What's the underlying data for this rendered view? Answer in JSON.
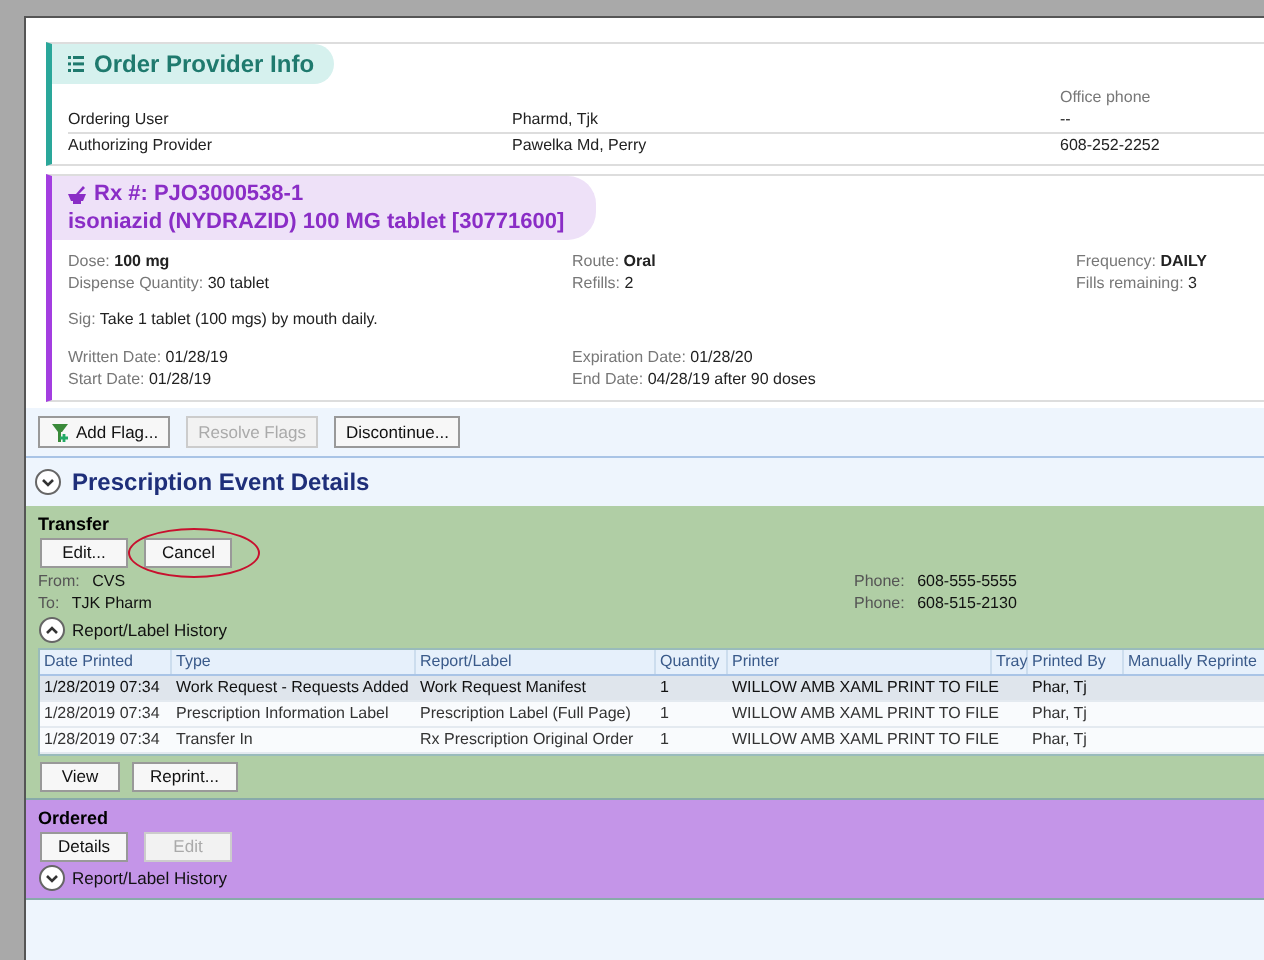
{
  "provider_info": {
    "title": "Order Provider Info",
    "phone_header": "Office phone",
    "rows": [
      {
        "label": "Ordering User",
        "name": "Pharmd, Tjk",
        "phone": "--"
      },
      {
        "label": "Authorizing Provider",
        "name": "Pawelka Md, Perry",
        "phone": "608-252-2252"
      }
    ]
  },
  "prescription": {
    "rx_number": "Rx #: PJO3000538-1",
    "drug": "isoniazid (NYDRAZID) 100 MG tablet [30771600]",
    "detail_columns": [
      [
        {
          "label": "Dose:",
          "value": "100 mg",
          "emphasis": true
        },
        {
          "label": "Dispense Quantity:",
          "value": "30 tablet",
          "emphasis": false
        }
      ],
      [
        {
          "label": "Route:",
          "value": "Oral",
          "emphasis": true
        },
        {
          "label": "Refills:",
          "value": "2",
          "emphasis": false
        }
      ],
      [
        {
          "label": "Frequency:",
          "value": "DAILY",
          "emphasis": true
        },
        {
          "label": "Fills remaining:",
          "value": "3",
          "emphasis": false
        }
      ]
    ],
    "sig": {
      "label": "Sig:",
      "value": "Take 1 tablet (100 mgs) by mouth daily."
    },
    "date_columns": [
      [
        {
          "label": "Written Date:",
          "value": "01/28/19",
          "emphasis": false
        },
        {
          "label": "Start Date:",
          "value": "01/28/19",
          "emphasis": false
        }
      ],
      [
        {
          "label": "Expiration Date:",
          "value": "01/28/20",
          "emphasis": false
        },
        {
          "label": "End Date:",
          "value": "04/28/19 after 90 doses",
          "emphasis": false
        }
      ]
    ]
  },
  "toolbar": [
    {
      "label": "Add Flag...",
      "kind": "flag",
      "disabled": false
    },
    {
      "label": "Resolve Flags",
      "kind": "plain",
      "disabled": true
    },
    {
      "label": "Discontinue...",
      "kind": "plain",
      "disabled": false
    }
  ],
  "event_details": {
    "title": "Prescription Event Details"
  },
  "events": [
    {
      "kind": "transfer",
      "title": "Transfer",
      "buttons": [
        {
          "label": "Edit...",
          "disabled": false,
          "circled": false
        },
        {
          "label": "Cancel",
          "disabled": false,
          "circled": true
        }
      ],
      "parties": [
        {
          "label": "From:",
          "value": "CVS",
          "phone_label": "Phone:",
          "phone": "608-555-5555"
        },
        {
          "label": "To:",
          "value": "TJK Pharm",
          "phone_label": "Phone:",
          "phone": "608-515-2130"
        }
      ],
      "history": {
        "label": "Report/Label History",
        "expanded": true,
        "columns": [
          "Date Printed",
          "Type",
          "Report/Label",
          "Quantity",
          "Printer",
          "Tray",
          "Printed By",
          "Manually Reprinte"
        ],
        "rows": [
          {
            "cells": [
              "1/28/2019 07:34",
              "Work Request - Requests Added",
              "Work Request Manifest",
              "1",
              "WILLOW AMB XAML PRINT TO FILE",
              "",
              "Phar, Tj",
              ""
            ],
            "selected": true
          },
          {
            "cells": [
              "1/28/2019 07:34",
              "Prescription Information Label",
              "Prescription Label (Full Page)",
              "1",
              "WILLOW AMB XAML PRINT TO FILE",
              "",
              "Phar, Tj",
              ""
            ],
            "selected": false
          },
          {
            "cells": [
              "1/28/2019 07:34",
              "Transfer In",
              "Rx Prescription Original Order",
              "1",
              "WILLOW AMB XAML PRINT TO FILE",
              "",
              "Phar, Tj",
              ""
            ],
            "selected": false
          }
        ],
        "buttons": [
          {
            "label": "View",
            "disabled": false
          },
          {
            "label": "Reprint...",
            "disabled": false
          }
        ]
      }
    },
    {
      "kind": "ordered",
      "title": "Ordered",
      "buttons": [
        {
          "label": "Details",
          "disabled": false,
          "circled": false
        },
        {
          "label": "Edit",
          "disabled": true,
          "circled": false
        }
      ],
      "history": {
        "label": "Report/Label History",
        "expanded": false
      }
    }
  ]
}
